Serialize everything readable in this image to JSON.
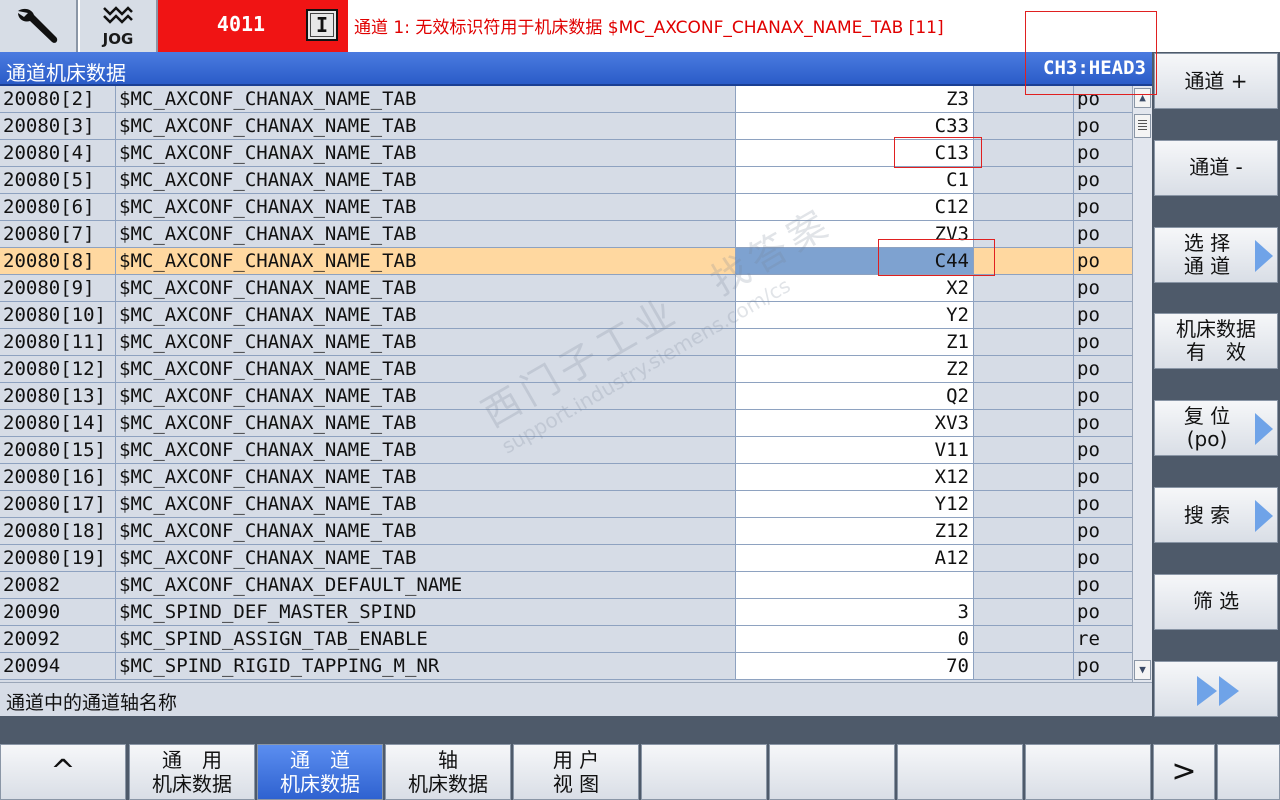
{
  "header": {
    "mode_label": "JOG",
    "alarm_number": "4011",
    "alarm_indicator": "I",
    "alarm_message": "通道 1: 无效标识符用于机床数据 $MC_AXCONF_CHANAX_NAME_TAB [11]"
  },
  "titlebar": {
    "title": "通道机床数据",
    "channel": "CH3:HEAD3"
  },
  "table": {
    "rows": [
      {
        "num": "20080[2]",
        "name": "$MC_AXCONF_CHANAX_NAME_TAB",
        "value": "Z3",
        "unit": "",
        "effect": "po"
      },
      {
        "num": "20080[3]",
        "name": "$MC_AXCONF_CHANAX_NAME_TAB",
        "value": "C33",
        "unit": "",
        "effect": "po"
      },
      {
        "num": "20080[4]",
        "name": "$MC_AXCONF_CHANAX_NAME_TAB",
        "value": "C13",
        "unit": "",
        "effect": "po"
      },
      {
        "num": "20080[5]",
        "name": "$MC_AXCONF_CHANAX_NAME_TAB",
        "value": "C1",
        "unit": "",
        "effect": "po"
      },
      {
        "num": "20080[6]",
        "name": "$MC_AXCONF_CHANAX_NAME_TAB",
        "value": "C12",
        "unit": "",
        "effect": "po"
      },
      {
        "num": "20080[7]",
        "name": "$MC_AXCONF_CHANAX_NAME_TAB",
        "value": "ZV3",
        "unit": "",
        "effect": "po"
      },
      {
        "num": "20080[8]",
        "name": "$MC_AXCONF_CHANAX_NAME_TAB",
        "value": "C44",
        "unit": "",
        "effect": "po",
        "selected": true
      },
      {
        "num": "20080[9]",
        "name": "$MC_AXCONF_CHANAX_NAME_TAB",
        "value": "X2",
        "unit": "",
        "effect": "po"
      },
      {
        "num": "20080[10]",
        "name": "$MC_AXCONF_CHANAX_NAME_TAB",
        "value": "Y2",
        "unit": "",
        "effect": "po"
      },
      {
        "num": "20080[11]",
        "name": "$MC_AXCONF_CHANAX_NAME_TAB",
        "value": "Z1",
        "unit": "",
        "effect": "po"
      },
      {
        "num": "20080[12]",
        "name": "$MC_AXCONF_CHANAX_NAME_TAB",
        "value": "Z2",
        "unit": "",
        "effect": "po"
      },
      {
        "num": "20080[13]",
        "name": "$MC_AXCONF_CHANAX_NAME_TAB",
        "value": "Q2",
        "unit": "",
        "effect": "po"
      },
      {
        "num": "20080[14]",
        "name": "$MC_AXCONF_CHANAX_NAME_TAB",
        "value": "XV3",
        "unit": "",
        "effect": "po"
      },
      {
        "num": "20080[15]",
        "name": "$MC_AXCONF_CHANAX_NAME_TAB",
        "value": "V11",
        "unit": "",
        "effect": "po"
      },
      {
        "num": "20080[16]",
        "name": "$MC_AXCONF_CHANAX_NAME_TAB",
        "value": "X12",
        "unit": "",
        "effect": "po"
      },
      {
        "num": "20080[17]",
        "name": "$MC_AXCONF_CHANAX_NAME_TAB",
        "value": "Y12",
        "unit": "",
        "effect": "po"
      },
      {
        "num": "20080[18]",
        "name": "$MC_AXCONF_CHANAX_NAME_TAB",
        "value": "Z12",
        "unit": "",
        "effect": "po"
      },
      {
        "num": "20080[19]",
        "name": "$MC_AXCONF_CHANAX_NAME_TAB",
        "value": "A12",
        "unit": "",
        "effect": "po"
      },
      {
        "num": "20082",
        "name": "$MC_AXCONF_CHANAX_DEFAULT_NAME",
        "value": "",
        "unit": "",
        "effect": "po"
      },
      {
        "num": "20090",
        "name": "$MC_SPIND_DEF_MASTER_SPIND",
        "value": "3",
        "unit": "",
        "effect": "po"
      },
      {
        "num": "20092",
        "name": "$MC_SPIND_ASSIGN_TAB_ENABLE",
        "value": "0",
        "unit": "",
        "effect": "re"
      },
      {
        "num": "20094",
        "name": "$MC_SPIND_RIGID_TAPPING_M_NR",
        "value": "70",
        "unit": "",
        "effect": "po"
      }
    ]
  },
  "description": "通道中的通道轴名称",
  "vertical_softkeys": [
    {
      "label": "通道 +",
      "arrow": false
    },
    {
      "label": "通道 -",
      "arrow": false
    },
    {
      "label": "选 择\n通 道",
      "arrow": true
    },
    {
      "label": "机床数据\n有　效",
      "arrow": false
    },
    {
      "label": "复 位\n(po)",
      "arrow": true
    },
    {
      "label": "搜 索",
      "arrow": true
    },
    {
      "label": "筛 选",
      "arrow": false
    },
    {
      "label": "",
      "icon": "double-right-icon"
    }
  ],
  "horizontal_softkeys": [
    {
      "label": "^",
      "glyph": true
    },
    {
      "label": "通　用\n机床数据"
    },
    {
      "label": "通　道\n机床数据",
      "active": true
    },
    {
      "label": "轴\n机床数据"
    },
    {
      "label": "用 户\n视 图"
    },
    {
      "label": ""
    },
    {
      "label": ""
    },
    {
      "label": ""
    },
    {
      "label": ""
    },
    {
      "label": ">",
      "glyph": true
    }
  ],
  "watermark": {
    "line1": "西门子工业　找答案",
    "line2": "support.industry.siemens.com/cs"
  },
  "colors": {
    "alarm_red": "#f01414",
    "title_blue": "#2b5cc8",
    "selected_row": "#ffd8a0",
    "selected_value": "#7ea2d0",
    "active_softkey": "#2f62d0"
  }
}
